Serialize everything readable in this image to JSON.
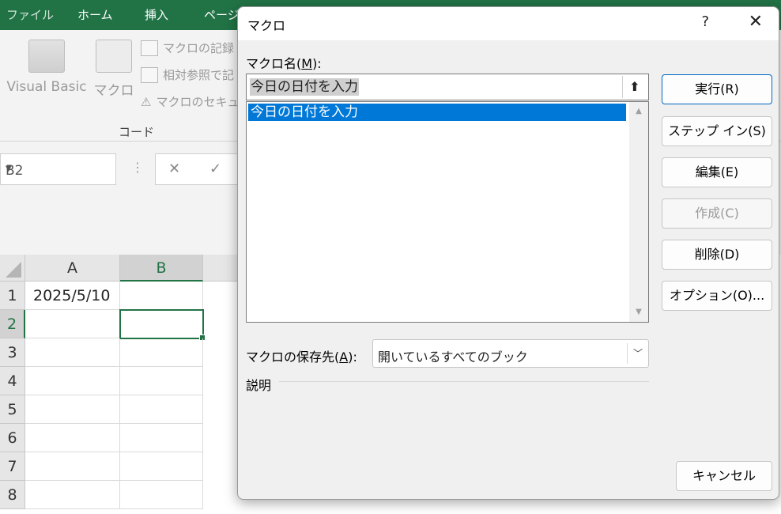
{
  "ribbon": {
    "tabs": [
      "ファイル",
      "ホーム",
      "挿入",
      "ページ"
    ],
    "visual_basic": "Visual Basic",
    "macro": "マクロ",
    "record_macro": "マクロの記録",
    "relative_ref": "相対参照で記",
    "macro_security": "マクロのセキュ",
    "group_label": "コード"
  },
  "formula_bar": {
    "name_box": "B2",
    "cancel_icon": "✕",
    "enter_icon": "✓"
  },
  "sheet": {
    "columns": [
      "A",
      "B"
    ],
    "rows": [
      "1",
      "2",
      "3",
      "4",
      "5",
      "6",
      "7",
      "8"
    ],
    "a1": "2025/5/10"
  },
  "dialog": {
    "title": "マクロ",
    "help": "?",
    "close": "✕",
    "name_label": "マクロ名(",
    "name_label_key": "M",
    "name_label_end": "):",
    "name_value": "今日の日付を入力",
    "list_items": [
      "今日の日付を入力"
    ],
    "location_label": "マクロの保存先(",
    "location_label_key": "A",
    "location_label_end": "):",
    "location_value": "開いているすべてのブック",
    "description_label": "説明",
    "buttons": {
      "run": "実行(R)",
      "step_into": "ステップ イン(S)",
      "edit": "編集(E)",
      "create": "作成(C)",
      "delete": "削除(D)",
      "options": "オプション(O)...",
      "cancel": "キャンセル"
    }
  }
}
